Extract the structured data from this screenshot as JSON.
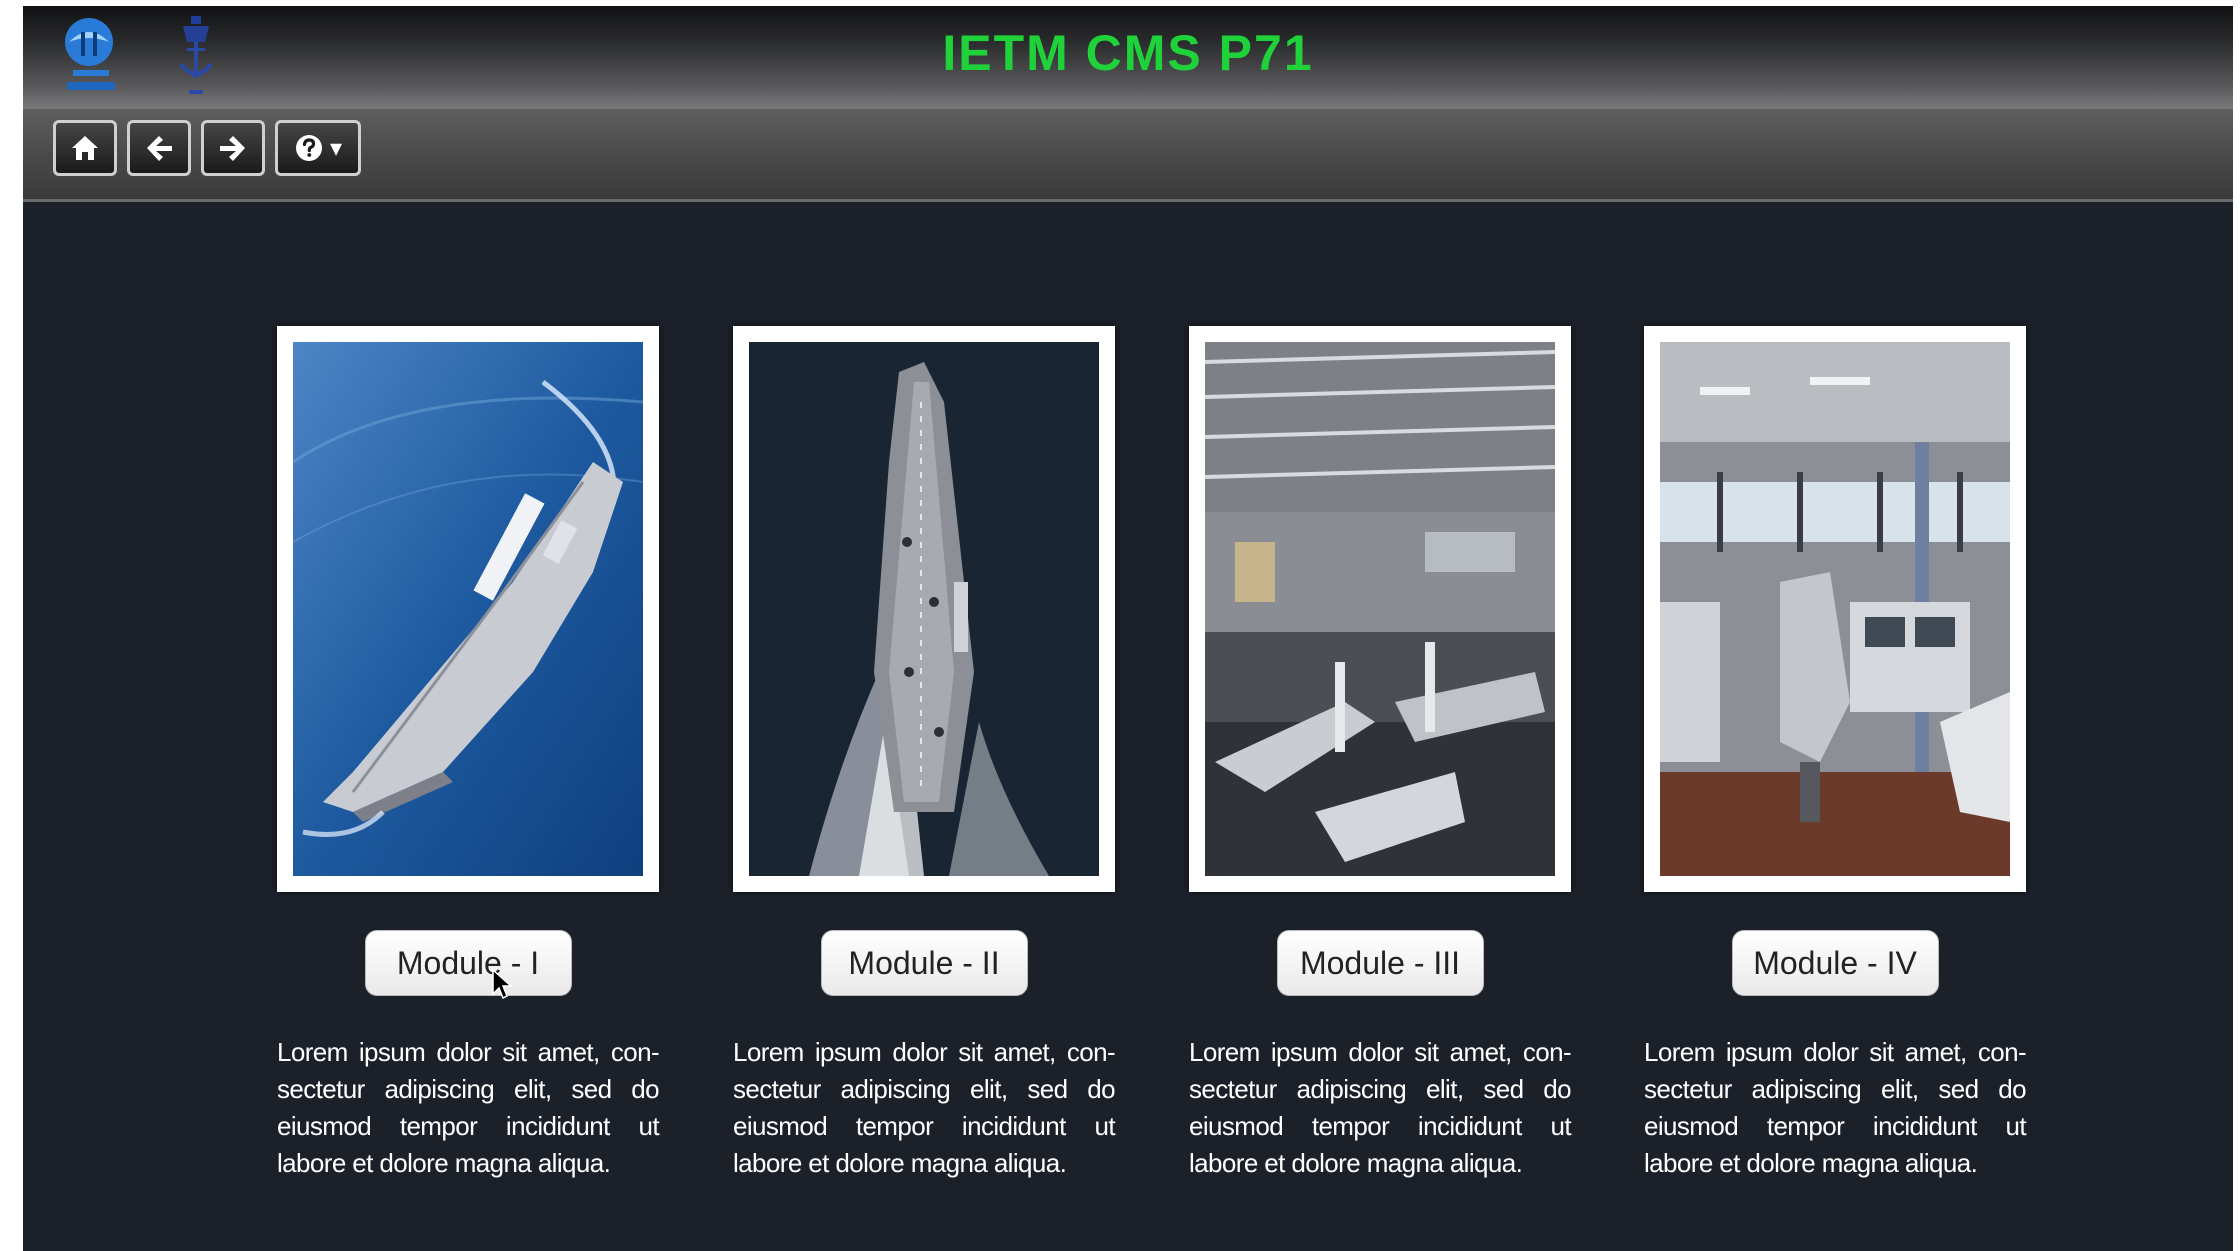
{
  "header": {
    "title": "IETM CMS P71",
    "title_color": "#20d23a",
    "logos": [
      {
        "name": "organization-logo"
      },
      {
        "name": "navy-crest-logo"
      }
    ]
  },
  "toolbar": {
    "buttons": [
      {
        "name": "home-button",
        "icon": "home-icon"
      },
      {
        "name": "back-button",
        "icon": "arrow-left-icon"
      },
      {
        "name": "forward-button",
        "icon": "arrow-right-icon"
      },
      {
        "name": "help-button",
        "icon": "question-circle-icon",
        "caret": "▾"
      }
    ]
  },
  "modules": [
    {
      "label": "Module - I",
      "image": "aircraft-carrier-at-sea",
      "description": "Lorem ipsum dolor sit amet, con-sectetur adipiscing elit, sed do eiusmod tempor incididunt ut labore et dolore magna aliqua."
    },
    {
      "label": "Module - II",
      "image": "carrier-top-down-view",
      "description": "Lorem ipsum dolor sit amet, con-sectetur adipiscing elit, sed do eiusmod tempor incididunt ut labore et dolore magna aliqua."
    },
    {
      "label": "Module - III",
      "image": "hangar-deck-aircraft",
      "description": "Lorem ipsum dolor sit amet, con-sectetur adipiscing elit, sed do eiusmod tempor incididunt ut labore et dolore magna aliqua."
    },
    {
      "label": "Module - IV",
      "image": "ship-bridge-interior",
      "description": "Lorem ipsum dolor sit amet, con-sectetur adipiscing elit, sed do eiusmod tempor incididunt ut labore et dolore magna aliqua."
    }
  ],
  "colors": {
    "background": "#1c2029",
    "button_border": "#cfcfcf"
  }
}
